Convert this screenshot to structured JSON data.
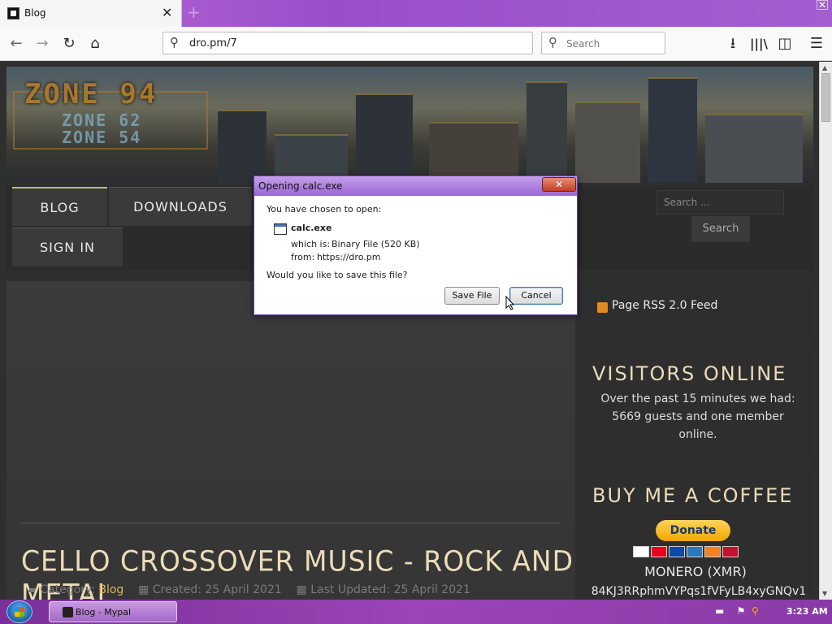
{
  "browser": {
    "tab_title": "Blog",
    "url": "dro.pm/7",
    "search_placeholder": "Search",
    "accent": "#9a4fc9"
  },
  "icons": {
    "back": "arrow-left-icon",
    "forward": "arrow-right-icon",
    "reload": "reload-icon",
    "home": "home-icon",
    "download": "download-icon",
    "library": "library-icon",
    "sidebar": "sidebar-icon",
    "menu": "hamburger-menu-icon",
    "rss": "rss-icon"
  },
  "site": {
    "logo_main": "ZONE 94",
    "logo_sub1": "ZONE 62",
    "logo_sub2": "ZONE 54",
    "menu": {
      "blog": "BLOG",
      "downloads": "DOWNLOADS",
      "sign_in": "SIGN IN"
    },
    "sidebar_search_placeholder": "Search ...",
    "sidebar_search_button": "Search",
    "rss_label": "Page RSS 2.0 Feed",
    "visitors_title": "VISITORS ONLINE",
    "visitors_body": "Over the past 15 minutes we had: 5669 guests and one member online.",
    "coffee_title": "BUY ME A COFFEE",
    "donate_label": "Donate",
    "xmr_label": "MONERO (XMR)",
    "xmr_address": "84KJ3RRphmVYPqs1fVFyLB4xyGNQv1",
    "article_title": "CELLO CROSSOVER MUSIC - ROCK AND METAL",
    "meta": {
      "category_label": "Category:",
      "category": "Blog",
      "created": "Created: 25 April 2021",
      "updated": "Last Updated: 25 April 2021"
    }
  },
  "dialog": {
    "title": "Opening calc.exe",
    "close": "✕",
    "intro": "You have chosen to open:",
    "filename": "calc.exe",
    "which_is_label": "which is:",
    "which_is_value": "Binary File (520 KB)",
    "from_label": "from:",
    "from_value": "https://dro.pm",
    "question": "Would you like to save this file?",
    "save_button": "Save File",
    "cancel_button": "Cancel"
  },
  "taskbar": {
    "window_label": "Blog - Mypal",
    "clock": "3:23 AM"
  }
}
